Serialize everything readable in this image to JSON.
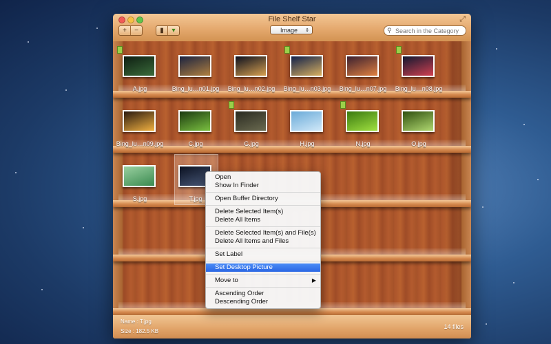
{
  "window": {
    "title": "File Shelf Star"
  },
  "toolbar": {
    "add_label": "+",
    "remove_label": "−",
    "category_value": "Image",
    "search_placeholder": "Search in the Category"
  },
  "items": [
    {
      "label": "A.jpg",
      "tagged": true,
      "colors": [
        "#0e1e12",
        "#3a6b3a"
      ]
    },
    {
      "label": "Bing_lu…n01.jpg",
      "tagged": false,
      "colors": [
        "#1a2240",
        "#b08040"
      ]
    },
    {
      "label": "Bing_lu…n02.jpg",
      "tagged": false,
      "colors": [
        "#0b0f1e",
        "#d6a050"
      ]
    },
    {
      "label": "Bing_lu…n03.jpg",
      "tagged": true,
      "colors": [
        "#10204a",
        "#d8b060"
      ]
    },
    {
      "label": "Bing_lu…n07.jpg",
      "tagged": false,
      "colors": [
        "#3a2030",
        "#e08040"
      ]
    },
    {
      "label": "Bing_lu…n08.jpg",
      "tagged": true,
      "colors": [
        "#101830",
        "#d04050"
      ]
    },
    {
      "label": "Bing_lu…n09.jpg",
      "tagged": false,
      "colors": [
        "#2a1a10",
        "#f0b040"
      ]
    },
    {
      "label": "C.jpg",
      "tagged": false,
      "colors": [
        "#1c3a10",
        "#7ac040"
      ]
    },
    {
      "label": "G.jpg",
      "tagged": true,
      "colors": [
        "#2a2a20",
        "#6a6a50"
      ]
    },
    {
      "label": "H.jpg",
      "tagged": false,
      "colors": [
        "#6aaad8",
        "#d0e8f8"
      ]
    },
    {
      "label": "N.jpg",
      "tagged": true,
      "colors": [
        "#3a7a10",
        "#a0e040"
      ]
    },
    {
      "label": "O.jpg",
      "tagged": false,
      "colors": [
        "#305010",
        "#b0d870"
      ]
    },
    {
      "label": "S.jpg",
      "tagged": false,
      "colors": [
        "#9ad0a0",
        "#3a8a50"
      ]
    },
    {
      "label": "T.jpg",
      "tagged": false,
      "colors": [
        "#0a1020",
        "#4a5a7a"
      ]
    }
  ],
  "context_menu": {
    "open": "Open",
    "show_in_finder": "Show In Finder",
    "open_buffer": "Open Buffer Directory",
    "delete_selected": "Delete Selected Item(s)",
    "delete_all": "Delete All Items",
    "delete_selected_files": "Delete Selected Item(s) and File(s)",
    "delete_all_files": "Delete All Items and Files",
    "set_label": "Set Label",
    "set_desktop": "Set Desktop Picture",
    "move_to": "Move to",
    "ascending": "Ascending Order",
    "descending": "Descending Order"
  },
  "footer": {
    "name": "Name : T.jpg",
    "size": "Size   : 182.5 KB",
    "count": "14 files"
  }
}
